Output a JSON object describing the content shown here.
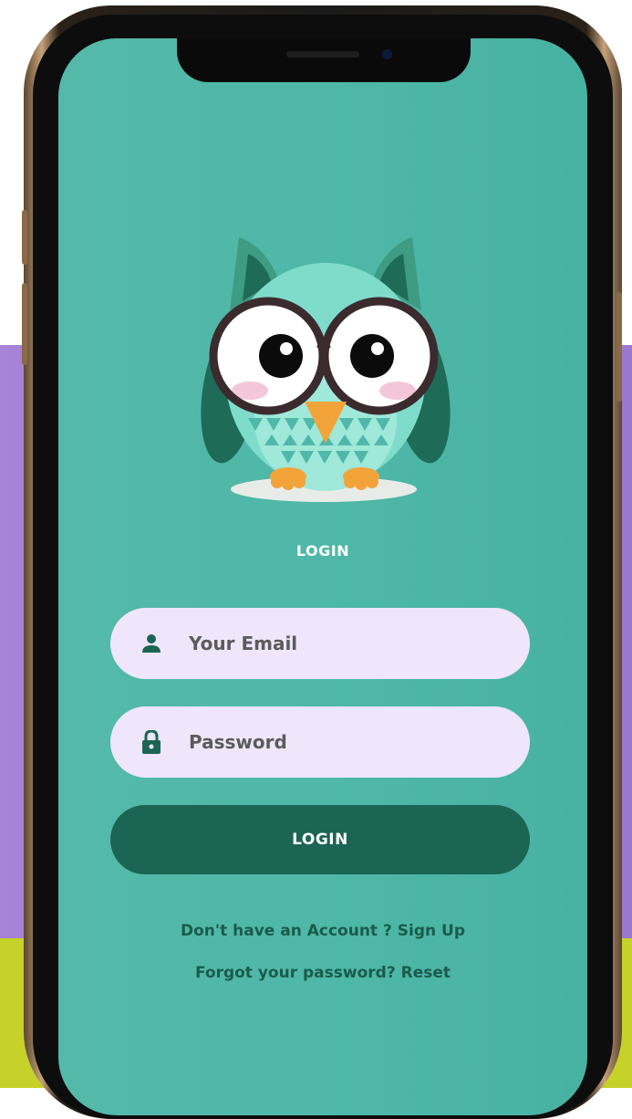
{
  "colors": {
    "screen_bg": "#4fb8a8",
    "field_bg": "#efe6fb",
    "button_bg": "#1c6554",
    "link_color": "#1a5b4d",
    "owl_body": "#7fdccb",
    "owl_dark": "#1e6b58",
    "owl_beak": "#f2a43a"
  },
  "login": {
    "title": "LOGIN",
    "email_placeholder": "Your Email",
    "password_placeholder": "Password",
    "submit_label": "LOGIN",
    "signup_text": "Don't have an Account ? Sign Up",
    "reset_text": "Forgot your password? Reset"
  },
  "icons": {
    "email": "user-icon",
    "password": "lock-icon",
    "mascot": "owl-mascot"
  }
}
